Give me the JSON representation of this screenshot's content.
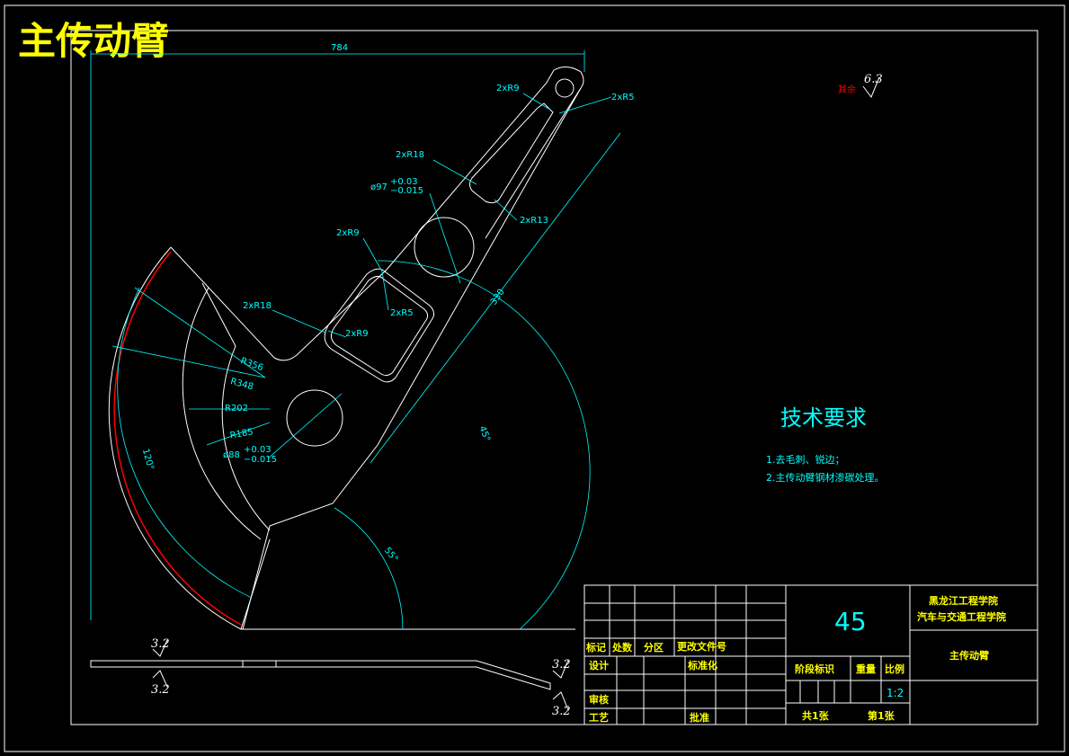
{
  "title": "主传动臂",
  "dimensions": {
    "overall_length": "784",
    "r9_top": "2xR9",
    "r5_top": "2xR5",
    "r18_top": "2xR18",
    "phi97_main": "ø97",
    "phi97_tol_up": "+0.03",
    "phi97_tol_down": "−0.015",
    "r13": "2xR13",
    "r9_mid": "2xR9",
    "r5_mid": "2xR5",
    "r18_mid": "2xR18",
    "r9_inner": "2xR9",
    "length_330": "330",
    "r356": "R356",
    "r348": "R348",
    "r202": "R202",
    "r185": "R185",
    "phi88_main": "ø88",
    "phi88_tol_up": "+0.03",
    "phi88_tol_down": "−0.015",
    "angle_120": "120°",
    "angle_45": "45°",
    "angle_55": "55°"
  },
  "roughness": {
    "rest_label": "其余",
    "rest_value": "6.3",
    "left_top": "3.2",
    "left_bottom": "3.2",
    "right_top": "3.2",
    "right_bottom": "3.2"
  },
  "tech_requirements": {
    "heading": "技术要求",
    "item1": "1.去毛刺、锐边；",
    "item2": "2.主传动臂钢材渗碳处理。"
  },
  "title_block": {
    "material": "45",
    "school_line1": "黑龙江工程学院",
    "school_line2": "汽车与交通工程学院",
    "part_name": "主传动臂",
    "col_mark": "标记",
    "col_count": "处数",
    "col_zone": "分区",
    "col_doc": "更改文件号",
    "design": "设计",
    "standard": "标准化",
    "review": "审核",
    "process": "工艺",
    "approve": "批准",
    "stage_mark": "阶段标识",
    "weight": "重量",
    "scale_label": "比例",
    "scale": "1:2",
    "total_sheets": "共1张",
    "sheet_no": "第1张"
  }
}
